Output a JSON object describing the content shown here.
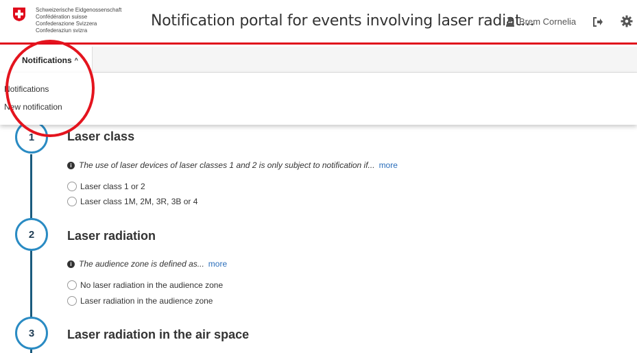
{
  "header": {
    "logo_lines": [
      "Schweizerische Eidgenossenschaft",
      "Confédération suisse",
      "Confederazione Svizzera",
      "Confederaziun svizra"
    ],
    "title": "Notification portal for events involving laser radiat...",
    "user_name": "Brem Cornelia"
  },
  "nav": {
    "tab_label": "Notifications",
    "dropdown_items": [
      "Notifications",
      "New notification"
    ]
  },
  "steps": [
    {
      "number": "1",
      "title": "Laser class",
      "info": "The use of laser devices of laser classes 1 and 2 is only subject to notification if...",
      "more": "more",
      "options": [
        "Laser class 1 or 2",
        "Laser class 1M, 2M, 3R, 3B or 4"
      ]
    },
    {
      "number": "2",
      "title": "Laser radiation",
      "info": "The audience zone is defined as...",
      "more": "more",
      "options": [
        "No laser radiation in the audience zone",
        "Laser radiation in the audience zone"
      ]
    },
    {
      "number": "3",
      "title": "Laser radiation in the air space"
    }
  ],
  "colors": {
    "accent_red": "#e00a1b",
    "step_blue": "#2a8bc3",
    "link_blue": "#2a6ebb"
  },
  "icons": {
    "logo": "swiss-cross-icon",
    "user": "user-icon",
    "logout": "logout-icon",
    "settings": "gear-icon",
    "info": "info-icon"
  }
}
